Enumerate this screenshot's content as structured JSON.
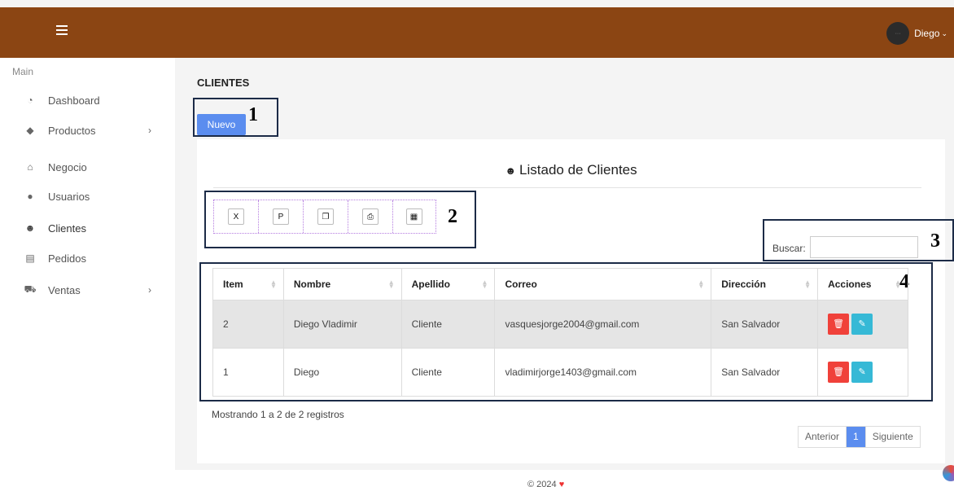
{
  "header": {
    "menu_icon": "hamburger-icon",
    "user_name": "Diego",
    "avatar_text": "···",
    "chevron": "⌄"
  },
  "sidebar": {
    "section_label": "Main",
    "items": [
      {
        "label": "Dashboard",
        "icon": "pie-chart-icon",
        "glyph": "◔",
        "has_arrow": false
      },
      {
        "label": "Productos",
        "icon": "tags-icon",
        "glyph": "◆",
        "has_arrow": true
      },
      {
        "label": "Negocio",
        "icon": "home-icon",
        "glyph": "⌂",
        "has_arrow": false
      },
      {
        "label": "Usuarios",
        "icon": "user-icon",
        "glyph": "●",
        "has_arrow": false
      },
      {
        "label": "Clientes",
        "icon": "users-icon",
        "glyph": "☻",
        "has_arrow": false
      },
      {
        "label": "Pedidos",
        "icon": "list-icon",
        "glyph": "▤",
        "has_arrow": false
      },
      {
        "label": "Ventas",
        "icon": "cart-icon",
        "glyph": "⛟",
        "has_arrow": true
      }
    ],
    "arrow_glyph": "›"
  },
  "page": {
    "title": "CLIENTES",
    "new_button": "Nuevo"
  },
  "card": {
    "title": "Listado de Clientes",
    "title_icon": "users-icon",
    "title_glyph": "☻"
  },
  "export_buttons": [
    {
      "name": "excel-export-button",
      "icon": "file-excel-icon",
      "glyph": "X"
    },
    {
      "name": "pdf-export-button",
      "icon": "file-pdf-icon",
      "glyph": "P"
    },
    {
      "name": "copy-button",
      "icon": "copy-icon",
      "glyph": "❐"
    },
    {
      "name": "print-button",
      "icon": "print-icon",
      "glyph": "⎙"
    },
    {
      "name": "csv-export-button",
      "icon": "file-csv-icon",
      "glyph": "▦"
    }
  ],
  "search": {
    "label": "Buscar:",
    "value": ""
  },
  "table": {
    "columns": [
      "Item",
      "Nombre",
      "Apellido",
      "Correo",
      "Dirección",
      "Acciones"
    ],
    "rows": [
      {
        "item": "2",
        "nombre": "Diego Vladimir",
        "apellido": "Cliente",
        "correo": "vasquesjorge2004@gmail.com",
        "direccion": "San Salvador"
      },
      {
        "item": "1",
        "nombre": "Diego",
        "apellido": "Cliente",
        "correo": "vladimirjorge1403@gmail.com",
        "direccion": "San Salvador"
      }
    ],
    "delete_glyph": "🗑",
    "edit_glyph": "✎"
  },
  "info_text": "Mostrando 1 a 2 de 2 registros",
  "pagination": {
    "prev": "Anterior",
    "current": "1",
    "next": "Siguiente"
  },
  "footer": {
    "text": "© 2024",
    "heart": "♥"
  },
  "annotations": [
    "1",
    "2",
    "3",
    "4"
  ],
  "colors": {
    "header": "#8b4513",
    "primary": "#5b8def",
    "danger": "#f0413a",
    "info": "#36b9d6"
  }
}
